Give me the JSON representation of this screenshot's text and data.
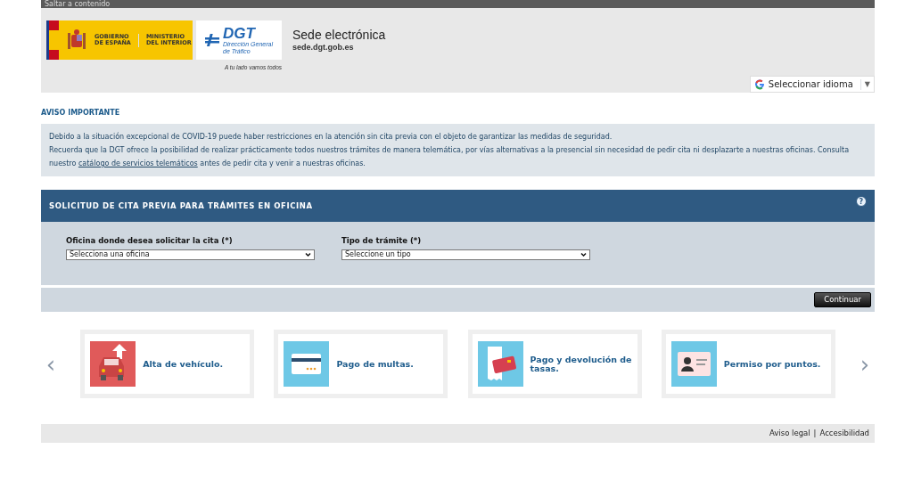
{
  "skip_link": "Saltar a contenido",
  "header": {
    "gov_logo": {
      "line1": "GOBIERNO",
      "line2": "DE ESPAÑA",
      "line3": "MINISTERIO",
      "line4": "DEL INTERIOR"
    },
    "dgt_logo": {
      "name": "DGT",
      "sub1": "Dirección General",
      "sub2": "de Tráfico",
      "tagline": "A tu lado vamos todos"
    },
    "title": "Sede electrónica",
    "subtitle": "sede.dgt.gob.es",
    "language": "Seleccionar idioma",
    "language_caret": "▼"
  },
  "notice": {
    "title": "AVISO IMPORTANTE",
    "line1": "Debido a la situación excepcional de COVID-19 puede haber restricciones en la atención sin cita previa con el objeto de garantizar las medidas de seguridad.",
    "line2_before": "Recuerda que la DGT ofrece la posibilidad de realizar prácticamente todos nuestros trámites de manera telemática, por vías alternativas a la presencial sin necesidad de pedir cita ni desplazarte a nuestras oficinas. Consulta nuestro",
    "link": "catálogo de servicios telemáticos",
    "line2_after": "antes de pedir cita y venir a nuestras oficinas."
  },
  "form": {
    "title": "SOLICITUD DE CITA PREVIA PARA TRÁMITES EN OFICINA",
    "help": "?",
    "fields": [
      {
        "label": "Oficina donde desea solicitar la cita (*)",
        "value": "Selecciona una oficina"
      },
      {
        "label": "Tipo de trámite (*)",
        "value": "Seleccione un tipo"
      }
    ],
    "submit": "Continuar"
  },
  "carousel": {
    "prev": "‹",
    "next": "›",
    "items": [
      {
        "kind": "car",
        "label": "Alta de vehículo."
      },
      {
        "kind": "card",
        "label": "Pago de multas."
      },
      {
        "kind": "receipt",
        "label": "Pago y devolución de tasas."
      },
      {
        "kind": "id",
        "label": "Permiso por puntos."
      }
    ]
  },
  "footer": {
    "links": [
      "Aviso legal",
      "Accesibilidad"
    ],
    "separator": "|"
  }
}
